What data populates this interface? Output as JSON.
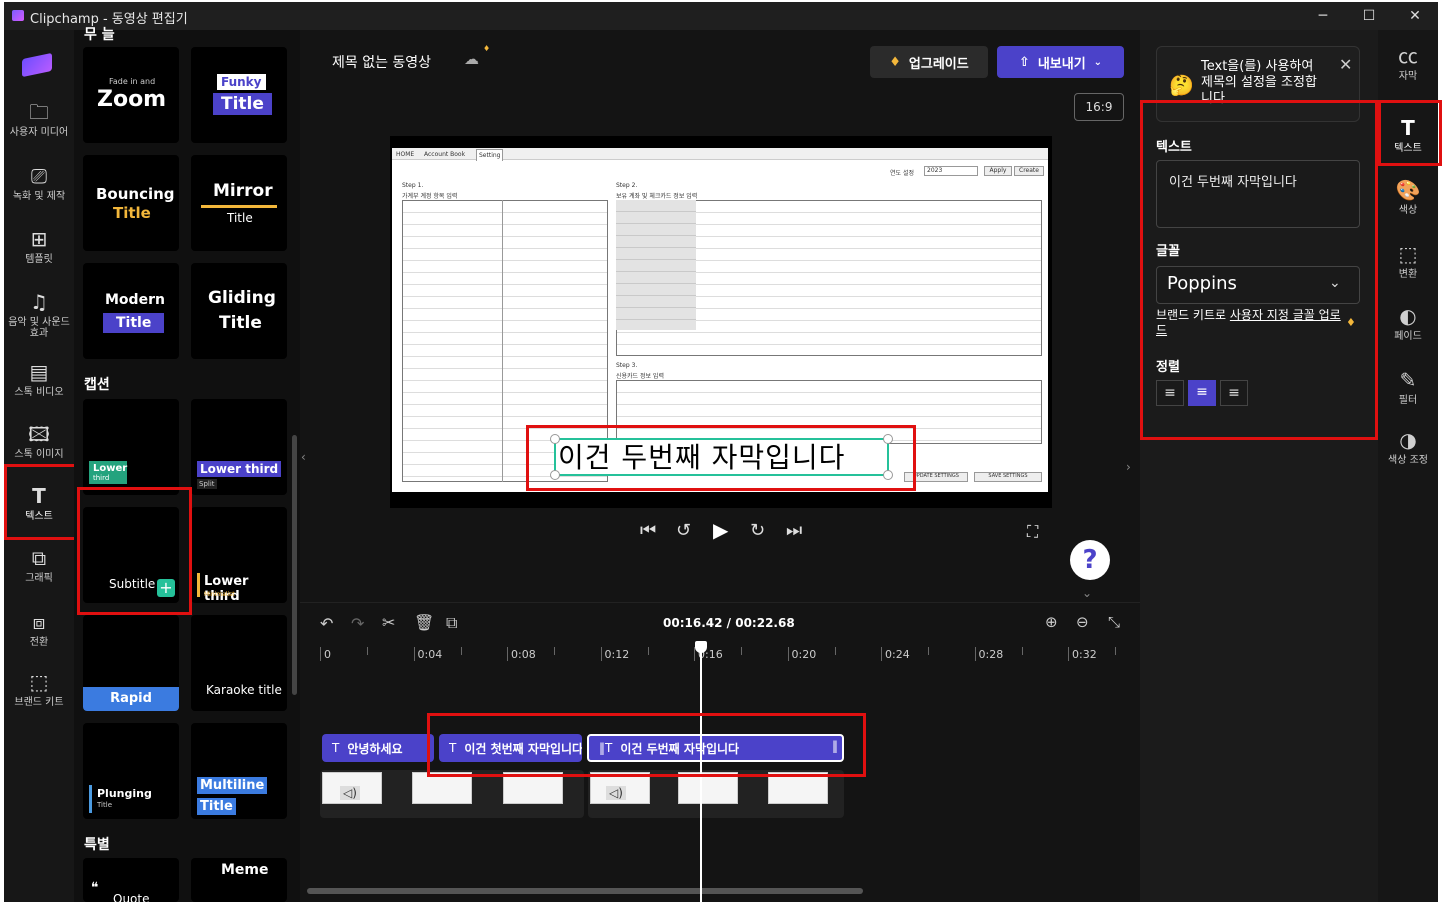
{
  "window": {
    "title": "Clipchamp - 동영상 편집기",
    "min": "─",
    "max": "☐",
    "close": "✕"
  },
  "leftnav": [
    {
      "label": "사용자 미디어",
      "icon": "folder-icon",
      "glyph": "🗀"
    },
    {
      "label": "녹화 및 제작",
      "icon": "video-record-icon",
      "glyph": "⎚"
    },
    {
      "label": "템플릿",
      "icon": "template-icon",
      "glyph": "⊞"
    },
    {
      "label": "음악 및 사운드 효과",
      "icon": "music-icon",
      "glyph": "♫"
    },
    {
      "label": "스톡 비디오",
      "icon": "stock-video-icon",
      "glyph": "▤"
    },
    {
      "label": "스톡 이미지",
      "icon": "stock-image-icon",
      "glyph": "🖾"
    },
    {
      "label": "텍스트",
      "icon": "text-icon",
      "glyph": "T"
    },
    {
      "label": "그래픽",
      "icon": "graphics-icon",
      "glyph": "⧉"
    },
    {
      "label": "전환",
      "icon": "transition-icon",
      "glyph": "⧈"
    },
    {
      "label": "브랜드 키트",
      "icon": "brand-kit-icon",
      "glyph": "⬚"
    }
  ],
  "library": {
    "top_cut_label": "무 늘",
    "tiles_top": [
      {
        "small": "Fade in and",
        "big": "Zoom"
      },
      {
        "line1": "Funky",
        "line2": "Title"
      },
      {
        "line1": "Bouncing",
        "line2": "Title"
      },
      {
        "line1": "Mirror",
        "line2": "Title"
      },
      {
        "line1": "Modern",
        "line2": "Title"
      },
      {
        "line1": "Gliding",
        "line2": "Title"
      }
    ],
    "captions_header": "캡션",
    "caption_tiles": [
      {
        "line1": "Lower",
        "line2": "third"
      },
      {
        "line1": "Lower third",
        "line2": "Split"
      },
      {
        "line1": "Subtitle",
        "add": "+"
      },
      {
        "line1": "Lower third",
        "line2": "Minimalist"
      },
      {
        "line1": "Rapid"
      },
      {
        "line1": "Karaoke title"
      },
      {
        "line1": "Plunging",
        "line2": "Title"
      },
      {
        "line1": "Multiline",
        "line2": "Title"
      }
    ],
    "special_header": "특별",
    "special_tiles": [
      {
        "line1": "Quote",
        "glyph": "❝"
      },
      {
        "line1": "Meme"
      }
    ]
  },
  "editor": {
    "project_title": "제목 없는 동영상",
    "upgrade_label": "업그레이드",
    "export_label": "내보내기",
    "aspect": "16:9",
    "caption_overlay": "이건 두번째 자막입니다",
    "time_current": "00:16.42",
    "time_total": "00:22.68",
    "time_sep": " / "
  },
  "preview_doc": {
    "tabs": [
      "HOME",
      "Account Book",
      "Setting"
    ],
    "year_label": "연도 설정",
    "year_value": "2023",
    "apply": "Apply",
    "create": "Create",
    "step1": "Step 1.",
    "step1_sub": "가계부 계정 항목 입력",
    "step2": "Step 2.",
    "step2_sub": "보유 계좌 및 체크카드 정보 입력",
    "step3": "Step 3.",
    "step3_sub": "신용카드 정보 입력",
    "update_btn": "UPDATE SETTINGS",
    "save_btn": "SAVE SETTINGS"
  },
  "ruler": [
    "0",
    "0:04",
    "0:08",
    "0:12",
    "0:16",
    "0:20",
    "0:24",
    "0:28",
    "0:32"
  ],
  "clips": [
    {
      "label": "안녕하세요"
    },
    {
      "label": "이건 첫번째 자막입니다"
    },
    {
      "label": "이건 두번째 자막입니다"
    }
  ],
  "props": {
    "tip": "Text을(를) 사용하여 제목의 설정을 조정합니다.",
    "text_header": "텍스트",
    "text_value": "이건 두번째 자막입니다",
    "font_header": "글꼴",
    "font_value": "Poppins",
    "brand_prefix": "브랜드 키트로 ",
    "brand_link": "사용자 지정 글꼴 업로드",
    "align_header": "정렬"
  },
  "rightnav": [
    {
      "label": "자막",
      "icon": "cc-icon",
      "glyph": "㏄"
    },
    {
      "label": "텍스트",
      "icon": "text-icon",
      "glyph": "T"
    },
    {
      "label": "색상",
      "icon": "palette-icon",
      "glyph": "🎨"
    },
    {
      "label": "변환",
      "icon": "transform-icon",
      "glyph": "⬚"
    },
    {
      "label": "페이드",
      "icon": "fade-icon",
      "glyph": "◐"
    },
    {
      "label": "필터",
      "icon": "filter-icon",
      "glyph": "✎"
    },
    {
      "label": "색상 조정",
      "icon": "color-adjust-icon",
      "glyph": "◑"
    }
  ],
  "colors": {
    "accent": "#4b42c9",
    "highlight": "#e01010",
    "teal": "#25c19a"
  }
}
